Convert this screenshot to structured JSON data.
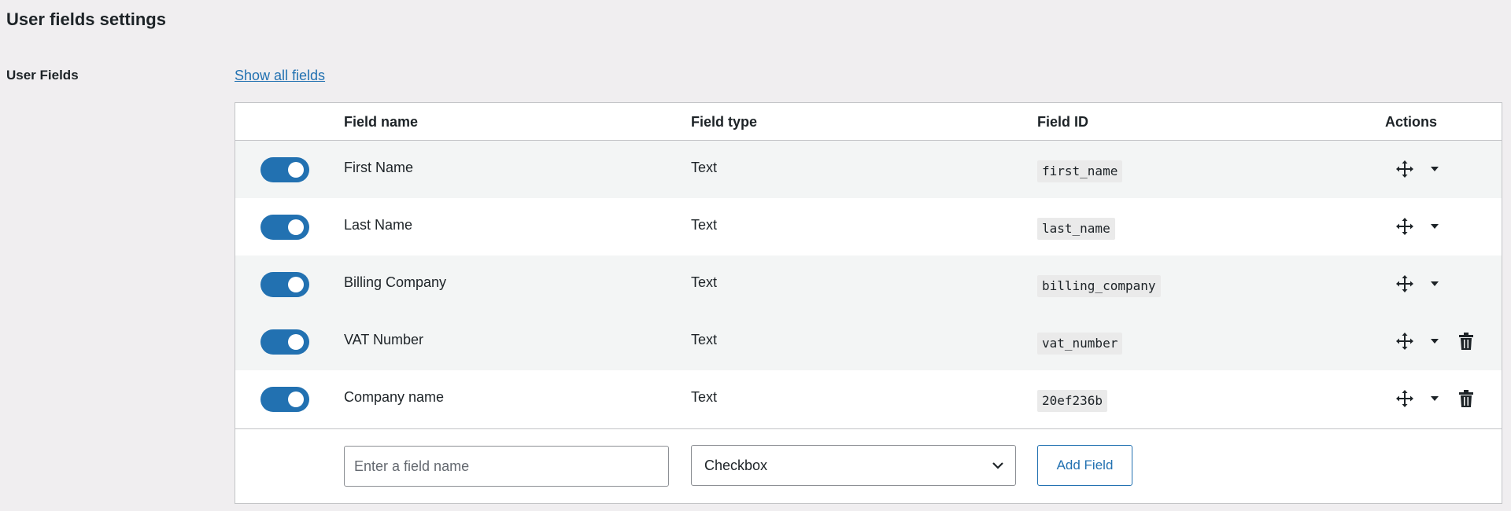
{
  "page": {
    "title": "User fields settings",
    "section_label": "User Fields",
    "show_all_link": "Show all fields"
  },
  "table": {
    "headers": {
      "name": "Field name",
      "type": "Field type",
      "id": "Field ID",
      "actions": "Actions"
    },
    "rows": [
      {
        "enabled": true,
        "name": "First Name",
        "type": "Text",
        "id": "first_name",
        "deletable": false
      },
      {
        "enabled": true,
        "name": "Last Name",
        "type": "Text",
        "id": "last_name",
        "deletable": false
      },
      {
        "enabled": true,
        "name": "Billing Company",
        "type": "Text",
        "id": "billing_company",
        "deletable": false
      },
      {
        "enabled": true,
        "name": "VAT Number",
        "type": "Text",
        "id": "vat_number",
        "deletable": true
      },
      {
        "enabled": true,
        "name": "Company name",
        "type": "Text",
        "id": "20ef236b",
        "deletable": true
      }
    ]
  },
  "add_field": {
    "name_placeholder": "Enter a field name",
    "name_value": "",
    "type_selected": "Checkbox",
    "button_label": "Add Field"
  },
  "icons": {
    "move": "move-icon",
    "dropdown": "chevron-down-icon",
    "delete": "trash-icon"
  },
  "colors": {
    "accent": "#2271b1",
    "toggle_on": "#2271b1",
    "background": "#f0eef0"
  }
}
